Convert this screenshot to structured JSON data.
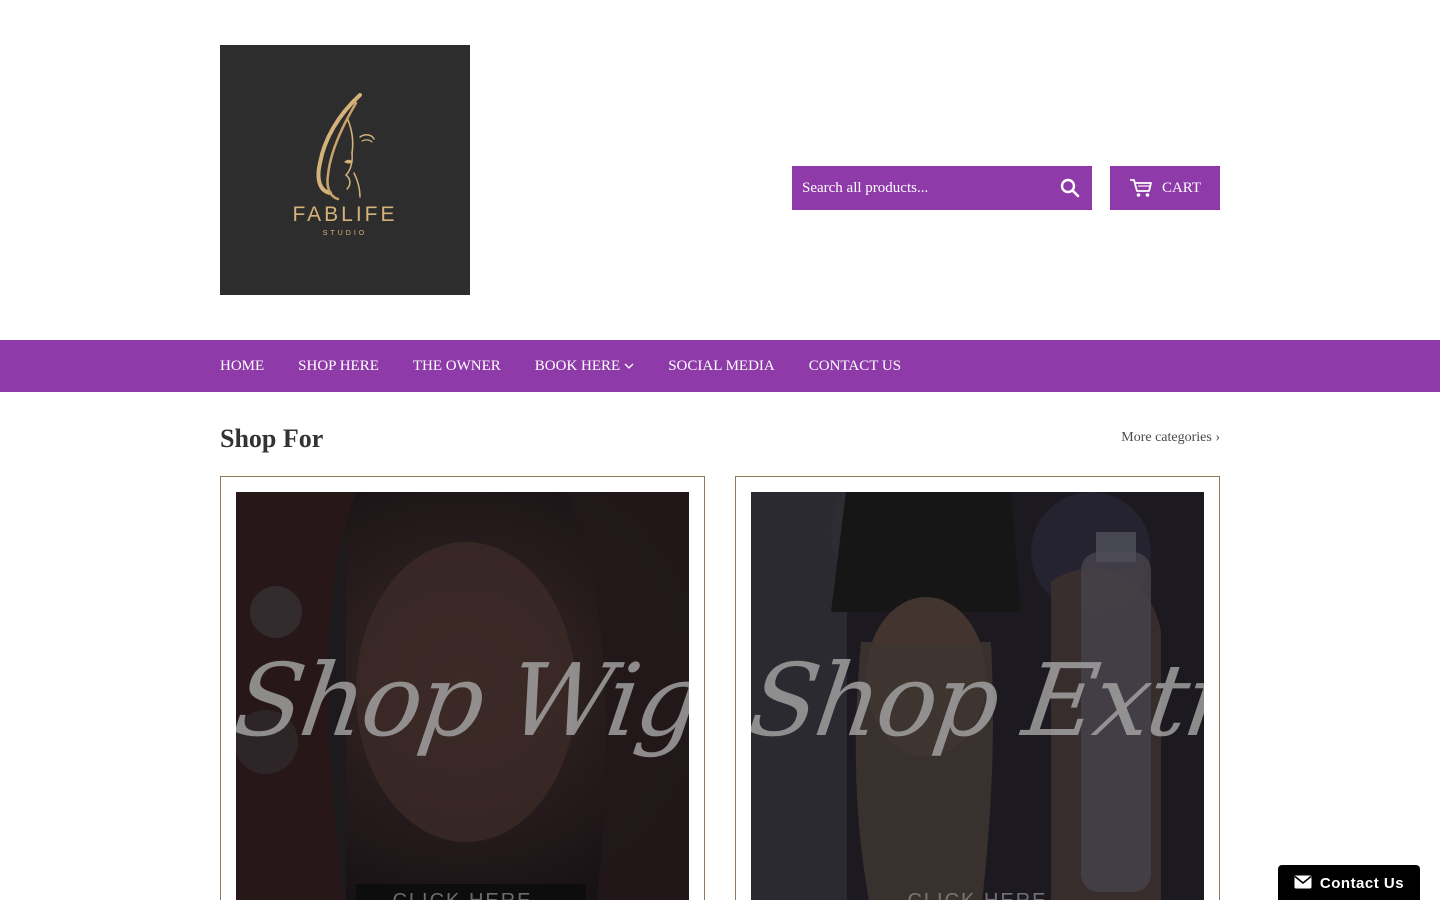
{
  "brand": {
    "name": "FABLIFE",
    "subtitle": "STUDIO",
    "logo_icon": "woman-profile-icon",
    "colors": {
      "logo_bg": "#2d2d2d",
      "logo_gold": "#d4b27a"
    }
  },
  "search": {
    "placeholder": "Search all products...",
    "icon": "search-icon"
  },
  "cart": {
    "label": "CART",
    "icon": "cart-icon"
  },
  "nav": {
    "items": [
      {
        "label": "HOME"
      },
      {
        "label": "SHOP HERE"
      },
      {
        "label": "THE OWNER"
      },
      {
        "label": "BOOK HERE",
        "has_dropdown": true
      },
      {
        "label": "SOCIAL MEDIA"
      },
      {
        "label": "CONTACT US"
      }
    ]
  },
  "section": {
    "title": "Shop For",
    "more_link": "More categories ›"
  },
  "cards": [
    {
      "script_text": "Shop Wigs",
      "cta": "CLICK HERE"
    },
    {
      "script_text": "Shop Extras",
      "cta": "CLICK HERE"
    }
  ],
  "contact_widget": {
    "label": "Contact Us",
    "icon": "envelope-icon"
  },
  "theme": {
    "accent": "#8e3aa8",
    "card_border": "#8f7a55",
    "text": "#333333"
  }
}
